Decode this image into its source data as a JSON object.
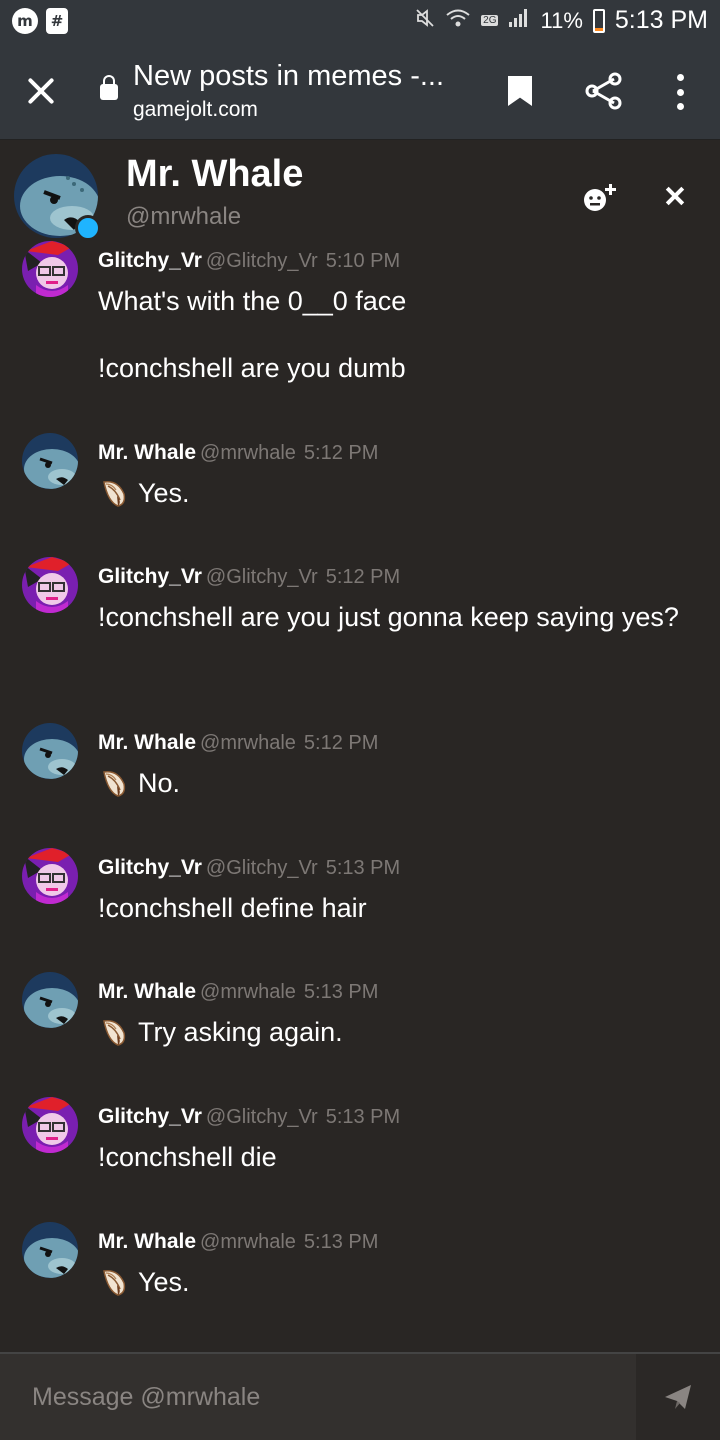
{
  "status_bar": {
    "battery_percent": "11%",
    "battery_level": 0.11,
    "network_badge": "2G",
    "time": "5:13 PM",
    "left_icons": [
      "app-icon",
      "notification-icon"
    ]
  },
  "browser": {
    "page_title": "New posts in memes -...",
    "url": "gamejolt.com"
  },
  "chat": {
    "contact_name": "Mr. Whale",
    "contact_handle": "@mrwhale",
    "online_color": "#1fb4ff"
  },
  "messages": [
    {
      "user": "Glitchy_Vr",
      "handle": "@Glitchy_Vr",
      "time": "5:10 PM",
      "avatar": "glitchy",
      "lines": [
        "What's with the 0__0 face",
        "!conchshell are you dumb"
      ]
    },
    {
      "user": "Mr. Whale",
      "handle": "@mrwhale",
      "time": "5:12 PM",
      "avatar": "whale",
      "shell": true,
      "text": "Yes."
    },
    {
      "user": "Glitchy_Vr",
      "handle": "@Glitchy_Vr",
      "time": "5:12 PM",
      "avatar": "glitchy",
      "lines": [
        "!conchshell are you just gonna keep saying yes?"
      ]
    },
    {
      "user": "Mr. Whale",
      "handle": "@mrwhale",
      "time": "5:12 PM",
      "avatar": "whale",
      "shell": true,
      "text": "No."
    },
    {
      "user": "Glitchy_Vr",
      "handle": "@Glitchy_Vr",
      "time": "5:13 PM",
      "avatar": "glitchy",
      "lines": [
        "!conchshell define hair"
      ]
    },
    {
      "user": "Mr. Whale",
      "handle": "@mrwhale",
      "time": "5:13 PM",
      "avatar": "whale",
      "shell": true,
      "text": "Try asking again."
    },
    {
      "user": "Glitchy_Vr",
      "handle": "@Glitchy_Vr",
      "time": "5:13 PM",
      "avatar": "glitchy",
      "lines": [
        "!conchshell die"
      ]
    },
    {
      "user": "Mr. Whale",
      "handle": "@mrwhale",
      "time": "5:13 PM",
      "avatar": "whale",
      "shell": true,
      "text": "Yes."
    }
  ],
  "composer": {
    "placeholder": "Message @mrwhale"
  },
  "colors": {
    "background": "#292624",
    "chrome": "#33373c",
    "muted_text": "#7d7875",
    "battery_low": "#ff8a1f"
  }
}
